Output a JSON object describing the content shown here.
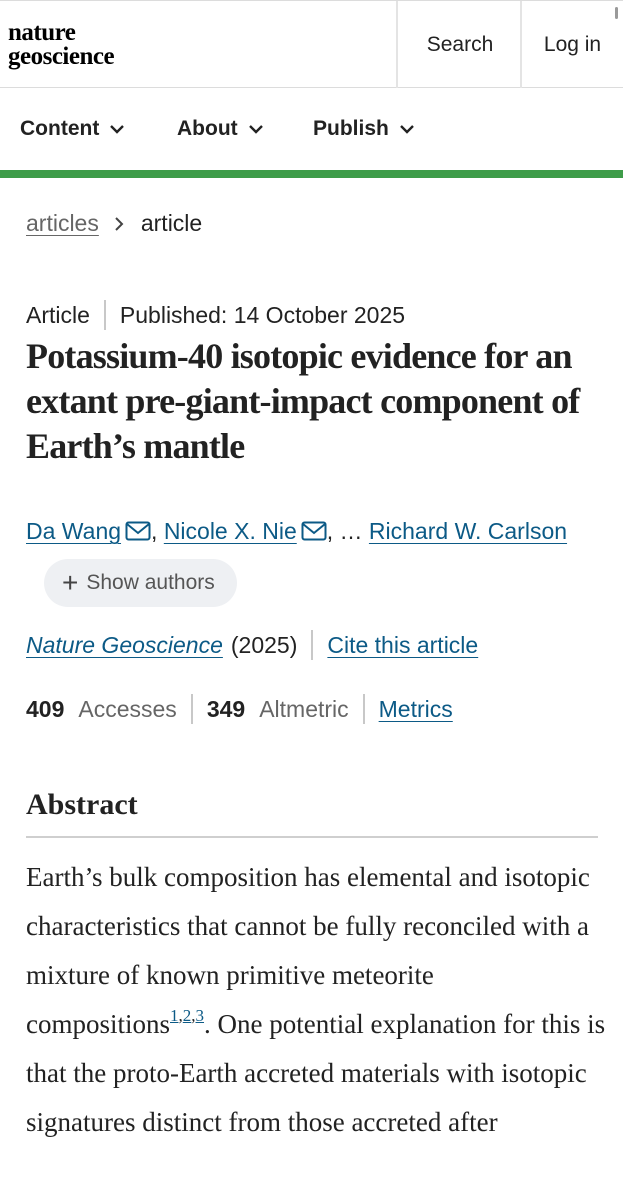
{
  "header": {
    "logo_line1": "nature",
    "logo_line2": "geoscience",
    "search_label": "Search",
    "login_label": "Log in"
  },
  "nav": {
    "content_label": "Content",
    "about_label": "About",
    "publish_label": "Publish"
  },
  "colors": {
    "accent_green": "#3e9c49",
    "link_blue": "#0c5a86"
  },
  "breadcrumb": {
    "parent": "articles",
    "current": "article"
  },
  "article": {
    "type": "Article",
    "published": "Published: 14 October 2025",
    "title": "Potassium-40 isotopic evidence for an extant pre-giant-impact component of Earth’s mantle",
    "authors": {
      "author1": "Da Wang",
      "author2": "Nicole X. Nie",
      "ellipsis": ", …",
      "author3": "Richard W. Carlson",
      "show_authors_label": "Show authors"
    },
    "journal": "Nature Geoscience",
    "year": "(2025)",
    "cite_label": "Cite this article",
    "accesses_count": "409",
    "accesses_label": "Accesses",
    "altmetric_count": "349",
    "altmetric_label": "Altmetric",
    "metrics_label": "Metrics"
  },
  "abstract": {
    "heading": "Abstract",
    "text_before_refs": "Earth’s bulk composition has elemental and isotopic characteristics that cannot be fully reconciled with a mixture of known primitive meteorite compositions",
    "ref1": "1",
    "ref2": "2",
    "ref3": "3",
    "text_after_refs": ". One potential explanation for this is that the proto-Earth accreted materials with isotopic signatures distinct from those accreted after"
  }
}
